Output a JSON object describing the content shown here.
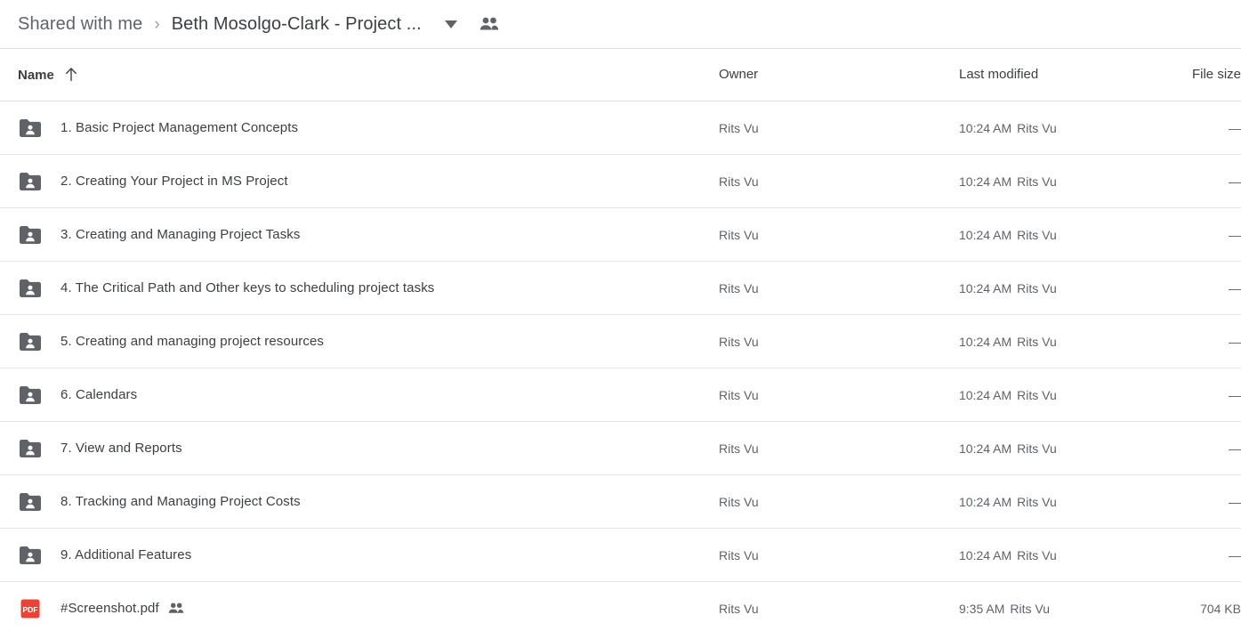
{
  "breadcrumb": {
    "parent": "Shared with me",
    "separator": "›",
    "current": "Beth Mosolgo-Clark - Project ...",
    "caret_icon": "chevron-down-icon",
    "people_icon": "people-icon"
  },
  "table": {
    "columns": {
      "name": "Name",
      "owner": "Owner",
      "modified": "Last modified",
      "size": "File size"
    },
    "sort": {
      "column": "Name",
      "direction": "ascending",
      "icon": "arrow-up-icon"
    },
    "rows": [
      {
        "icon": "shared-folder-icon",
        "name": "1. Basic Project Management Concepts",
        "shared": false,
        "owner": "Rits Vu",
        "modified_time": "10:24 AM",
        "modified_by": "Rits Vu",
        "size": "—"
      },
      {
        "icon": "shared-folder-icon",
        "name": "2. Creating Your Project in MS Project",
        "shared": false,
        "owner": "Rits Vu",
        "modified_time": "10:24 AM",
        "modified_by": "Rits Vu",
        "size": "—"
      },
      {
        "icon": "shared-folder-icon",
        "name": "3. Creating and Managing Project Tasks",
        "shared": false,
        "owner": "Rits Vu",
        "modified_time": "10:24 AM",
        "modified_by": "Rits Vu",
        "size": "—"
      },
      {
        "icon": "shared-folder-icon",
        "name": "4. The Critical Path and Other keys to scheduling project tasks",
        "shared": false,
        "owner": "Rits Vu",
        "modified_time": "10:24 AM",
        "modified_by": "Rits Vu",
        "size": "—"
      },
      {
        "icon": "shared-folder-icon",
        "name": "5. Creating and managing project resources",
        "shared": false,
        "owner": "Rits Vu",
        "modified_time": "10:24 AM",
        "modified_by": "Rits Vu",
        "size": "—"
      },
      {
        "icon": "shared-folder-icon",
        "name": "6. Calendars",
        "shared": false,
        "owner": "Rits Vu",
        "modified_time": "10:24 AM",
        "modified_by": "Rits Vu",
        "size": "—"
      },
      {
        "icon": "shared-folder-icon",
        "name": "7. View and Reports",
        "shared": false,
        "owner": "Rits Vu",
        "modified_time": "10:24 AM",
        "modified_by": "Rits Vu",
        "size": "—"
      },
      {
        "icon": "shared-folder-icon",
        "name": "8. Tracking and Managing Project Costs",
        "shared": false,
        "owner": "Rits Vu",
        "modified_time": "10:24 AM",
        "modified_by": "Rits Vu",
        "size": "—"
      },
      {
        "icon": "shared-folder-icon",
        "name": "9. Additional Features",
        "shared": false,
        "owner": "Rits Vu",
        "modified_time": "10:24 AM",
        "modified_by": "Rits Vu",
        "size": "—"
      },
      {
        "icon": "pdf-file-icon",
        "name": "#Screenshot.pdf",
        "shared": true,
        "owner": "Rits Vu",
        "modified_time": "9:35 AM",
        "modified_by": "Rits Vu",
        "size": "704 KB"
      }
    ]
  },
  "colors": {
    "folder_icon": "#5f6368",
    "pdf_icon": "#ea4335",
    "text_primary": "#3c4043",
    "text_secondary": "#5f6368",
    "divider": "#e0e0e0"
  }
}
